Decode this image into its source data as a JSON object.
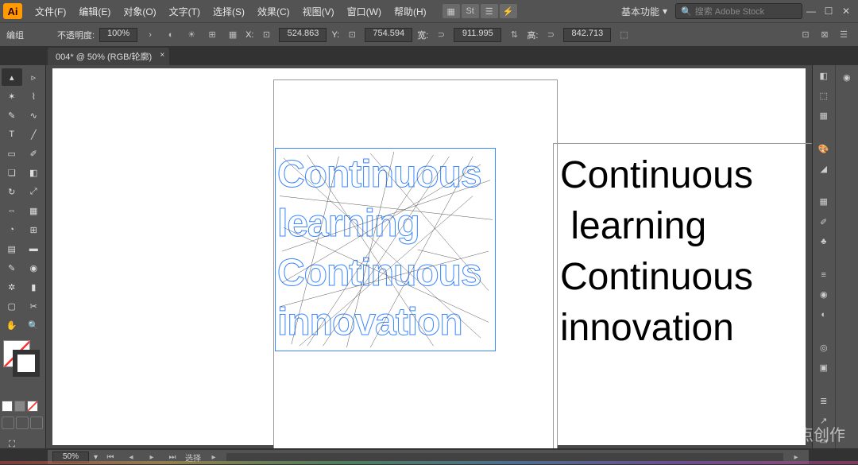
{
  "app": {
    "logo": "Ai"
  },
  "menu": {
    "file": "文件(F)",
    "edit": "编辑(E)",
    "object": "对象(O)",
    "type": "文字(T)",
    "select": "选择(S)",
    "effect": "效果(C)",
    "view": "视图(V)",
    "window": "窗口(W)",
    "help": "帮助(H)"
  },
  "workspace": {
    "label": "基本功能",
    "chev": "▾"
  },
  "search": {
    "icon": "🔍",
    "placeholder": "搜索 Adobe Stock"
  },
  "win": {
    "min": "—",
    "max": "☐",
    "close": "✕"
  },
  "control": {
    "mode": "编组",
    "opacity_label": "不透明度:",
    "opacity_value": "100%",
    "x_label": "X:",
    "x_value": "524.863",
    "y_label": "Y:",
    "y_value": "754.594",
    "w_label": "宽:",
    "w_value": "911.995",
    "h_label": "高:",
    "h_value": "842.713"
  },
  "tab": {
    "title": "004* @ 50% (RGB/轮廓)",
    "close": "×"
  },
  "artwork": {
    "line1": "Continuous",
    "line2": "learning",
    "line3": "Continuous",
    "line4": "innovation"
  },
  "footer": {
    "zoom": "50%",
    "sel": "选择",
    "chev": "▾"
  },
  "panels": {
    "left": [
      "layers",
      "cc",
      "lib",
      "export",
      "color-guide",
      "swatches",
      "brushes",
      "symbols",
      "stroke",
      "grad",
      "transp",
      "appearance",
      "styles",
      "align",
      "pathfinder",
      "transform"
    ],
    "right": [
      "properties",
      "cc-lib",
      "libraries",
      "export-as",
      "color",
      "sw2",
      "br2",
      "sy2",
      "st2",
      "gr2",
      "tr2",
      "ap2",
      "gs2",
      "al2",
      "pf2"
    ]
  },
  "watermark": {
    "text": "整点创作"
  }
}
